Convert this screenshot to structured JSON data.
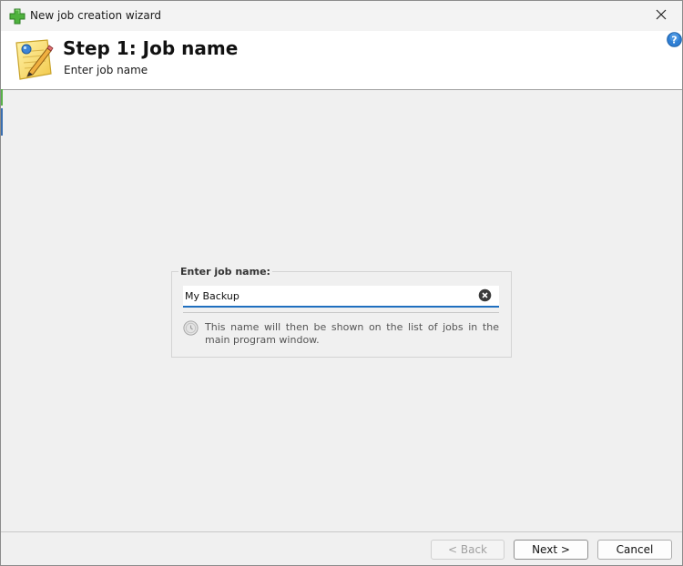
{
  "window": {
    "title": "New job creation wizard",
    "app_icon": "green-plus-icon",
    "close_icon": "close-icon"
  },
  "header": {
    "step_title": "Step 1: Job name",
    "step_subtitle": "Enter job name",
    "icon": "notepad-pencil-icon",
    "help_icon": "help-icon"
  },
  "form": {
    "group_label": "Enter job name:",
    "job_name_value": "My Backup",
    "clear_icon": "clear-icon",
    "hint_icon": "info-icon",
    "hint_text": "This name will then be shown on the list of jobs in the main program window."
  },
  "buttons": {
    "back_label": "< Back",
    "next_label": "Next >",
    "cancel_label": "Cancel",
    "back_enabled": false
  },
  "colors": {
    "accent_blue": "#1f6fbf",
    "header_bg": "#ffffff",
    "window_bg": "#f0f0f0",
    "icon_green": "#58b148"
  }
}
